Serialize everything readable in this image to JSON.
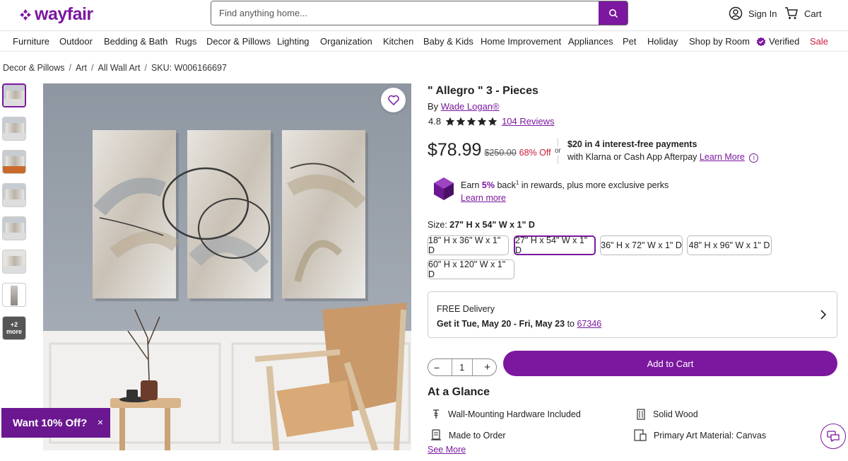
{
  "brand": {
    "name": "wayfair",
    "color": "#7b189f"
  },
  "search": {
    "placeholder": "Find anything home..."
  },
  "header": {
    "sign_in": "Sign In",
    "cart": "Cart"
  },
  "nav": [
    "Furniture",
    "Outdoor",
    "Bedding & Bath",
    "Rugs",
    "Decor & Pillows",
    "Lighting",
    "Organization",
    "Kitchen",
    "Baby & Kids",
    "Home Improvement",
    "Appliances",
    "Pet",
    "Holiday",
    "Shop by Room",
    "Verified",
    "Sale"
  ],
  "breadcrumb": [
    "Decor & Pillows",
    "Art",
    "All Wall Art",
    "SKU: W006166697"
  ],
  "thumbnails": {
    "more_count": "+2",
    "more_label": "more"
  },
  "promo": {
    "label": "Want 10% Off?",
    "close": "×"
  },
  "product": {
    "title": "\" Allegro \" 3 - Pieces",
    "by_prefix": "By",
    "brand": "Wade Logan®",
    "rating": "4.8",
    "reviews": "104 Reviews",
    "price": "$78.99",
    "old_price": "$250.00",
    "discount": "68% Off",
    "or": "or",
    "installments": "$20 in 4 interest-free payments",
    "installments_sub": "with Klarna or Cash App Afterpay",
    "learn_more": "Learn More",
    "rewards_earn": "Earn",
    "rewards_pct": "5%",
    "rewards_back": "back",
    "rewards_sup": "1",
    "rewards_rest": "in rewards, plus more exclusive perks",
    "rewards_link": "Learn more"
  },
  "size": {
    "label": "Size:",
    "selected": "27\" H x 54\" W x 1\" D",
    "options": [
      "18\" H x 36\" W x 1\" D",
      "27\" H x 54\" W x 1\" D",
      "36\" H x 72\" W x 1\" D",
      "48\" H x 96\" W x 1\" D",
      "60\" H x 120\" W x 1\" D"
    ]
  },
  "delivery": {
    "title": "FREE Delivery",
    "get_it": "Get it Tue, May 20 - Fri, May 23",
    "to": "to",
    "zip": "67346"
  },
  "cart": {
    "quantity": "1",
    "add_label": "Add to Cart",
    "minus": "−",
    "plus": "+"
  },
  "glance": {
    "title": "At a Glance",
    "features": [
      {
        "label": "Wall-Mounting Hardware Included",
        "icon": "screw-icon"
      },
      {
        "label": "Solid Wood",
        "icon": "wood-grain-icon"
      },
      {
        "label": "Made to Order",
        "icon": "made-to-order-icon"
      },
      {
        "label": "Primary Art Material: Canvas",
        "icon": "canvas-frame-icon"
      }
    ],
    "see_more": "See More"
  },
  "colors": {
    "accent": "#7b189f",
    "sale": "#c8203b"
  }
}
